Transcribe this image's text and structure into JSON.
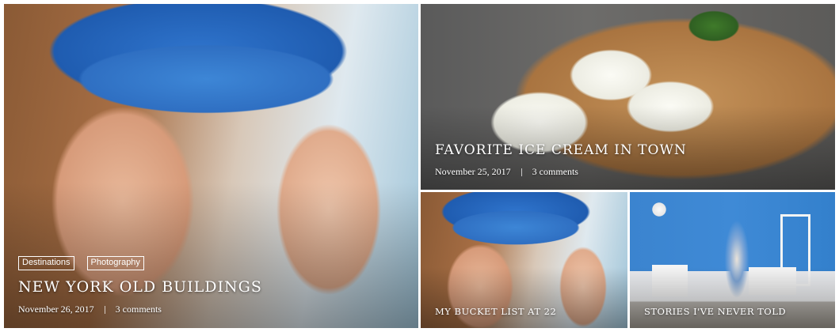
{
  "posts": [
    {
      "tags": [
        "Destinations",
        "Photography"
      ],
      "title": "NEW YORK OLD BUILDINGS",
      "date": "November 26, 2017",
      "comments": "3 comments"
    },
    {
      "title": "FAVORITE ICE CREAM IN TOWN",
      "date": "November 25, 2017",
      "comments": "3 comments"
    },
    {
      "title": "MY BUCKET LIST AT 22"
    },
    {
      "title": "STORIES I'VE NEVER TOLD"
    }
  ],
  "colors": {
    "text": "#ffffff",
    "background": "#ffffff",
    "hat_blue": "#2f74cc",
    "wall_blue": "#3b84cf"
  }
}
